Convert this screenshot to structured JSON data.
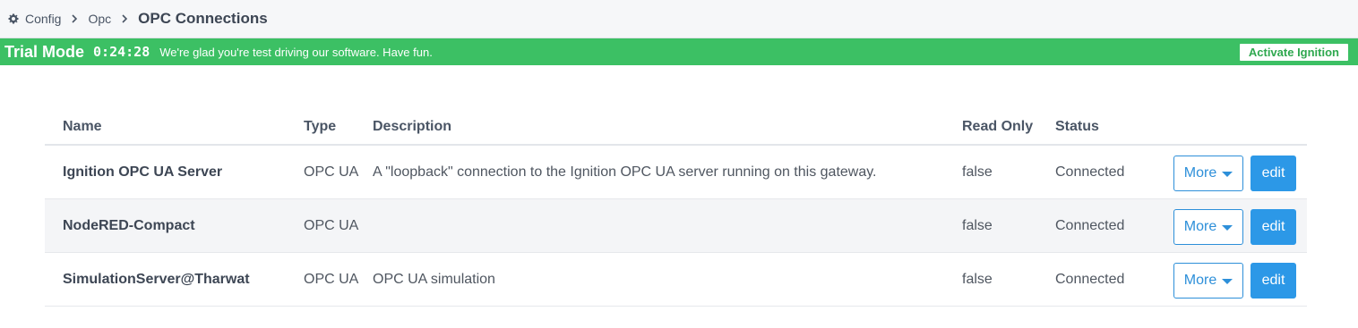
{
  "breadcrumb": {
    "icon": "gear-icon",
    "items": [
      "Config",
      "Opc"
    ],
    "current": "OPC Connections"
  },
  "trial": {
    "title": "Trial Mode",
    "timer": "0:24:28",
    "message": "We're glad you're test driving our software. Have fun.",
    "activate_label": "Activate Ignition",
    "color": "#3cc064"
  },
  "table": {
    "columns": [
      "Name",
      "Type",
      "Description",
      "Read Only",
      "Status"
    ],
    "rows": [
      {
        "name": "Ignition OPC UA Server",
        "type": "OPC UA",
        "description": "A \"loopback\" connection to the Ignition OPC UA server running on this gateway.",
        "read_only": "false",
        "status": "Connected",
        "more_label": "More",
        "edit_label": "edit"
      },
      {
        "name": "NodeRED-Compact",
        "type": "OPC UA",
        "description": "",
        "read_only": "false",
        "status": "Connected",
        "more_label": "More",
        "edit_label": "edit"
      },
      {
        "name": "SimulationServer@Tharwat",
        "type": "OPC UA",
        "description": "OPC UA simulation",
        "read_only": "false",
        "status": "Connected",
        "more_label": "More",
        "edit_label": "edit"
      }
    ]
  },
  "colors": {
    "accent": "#2c98e7",
    "trial_green": "#3cc064"
  }
}
